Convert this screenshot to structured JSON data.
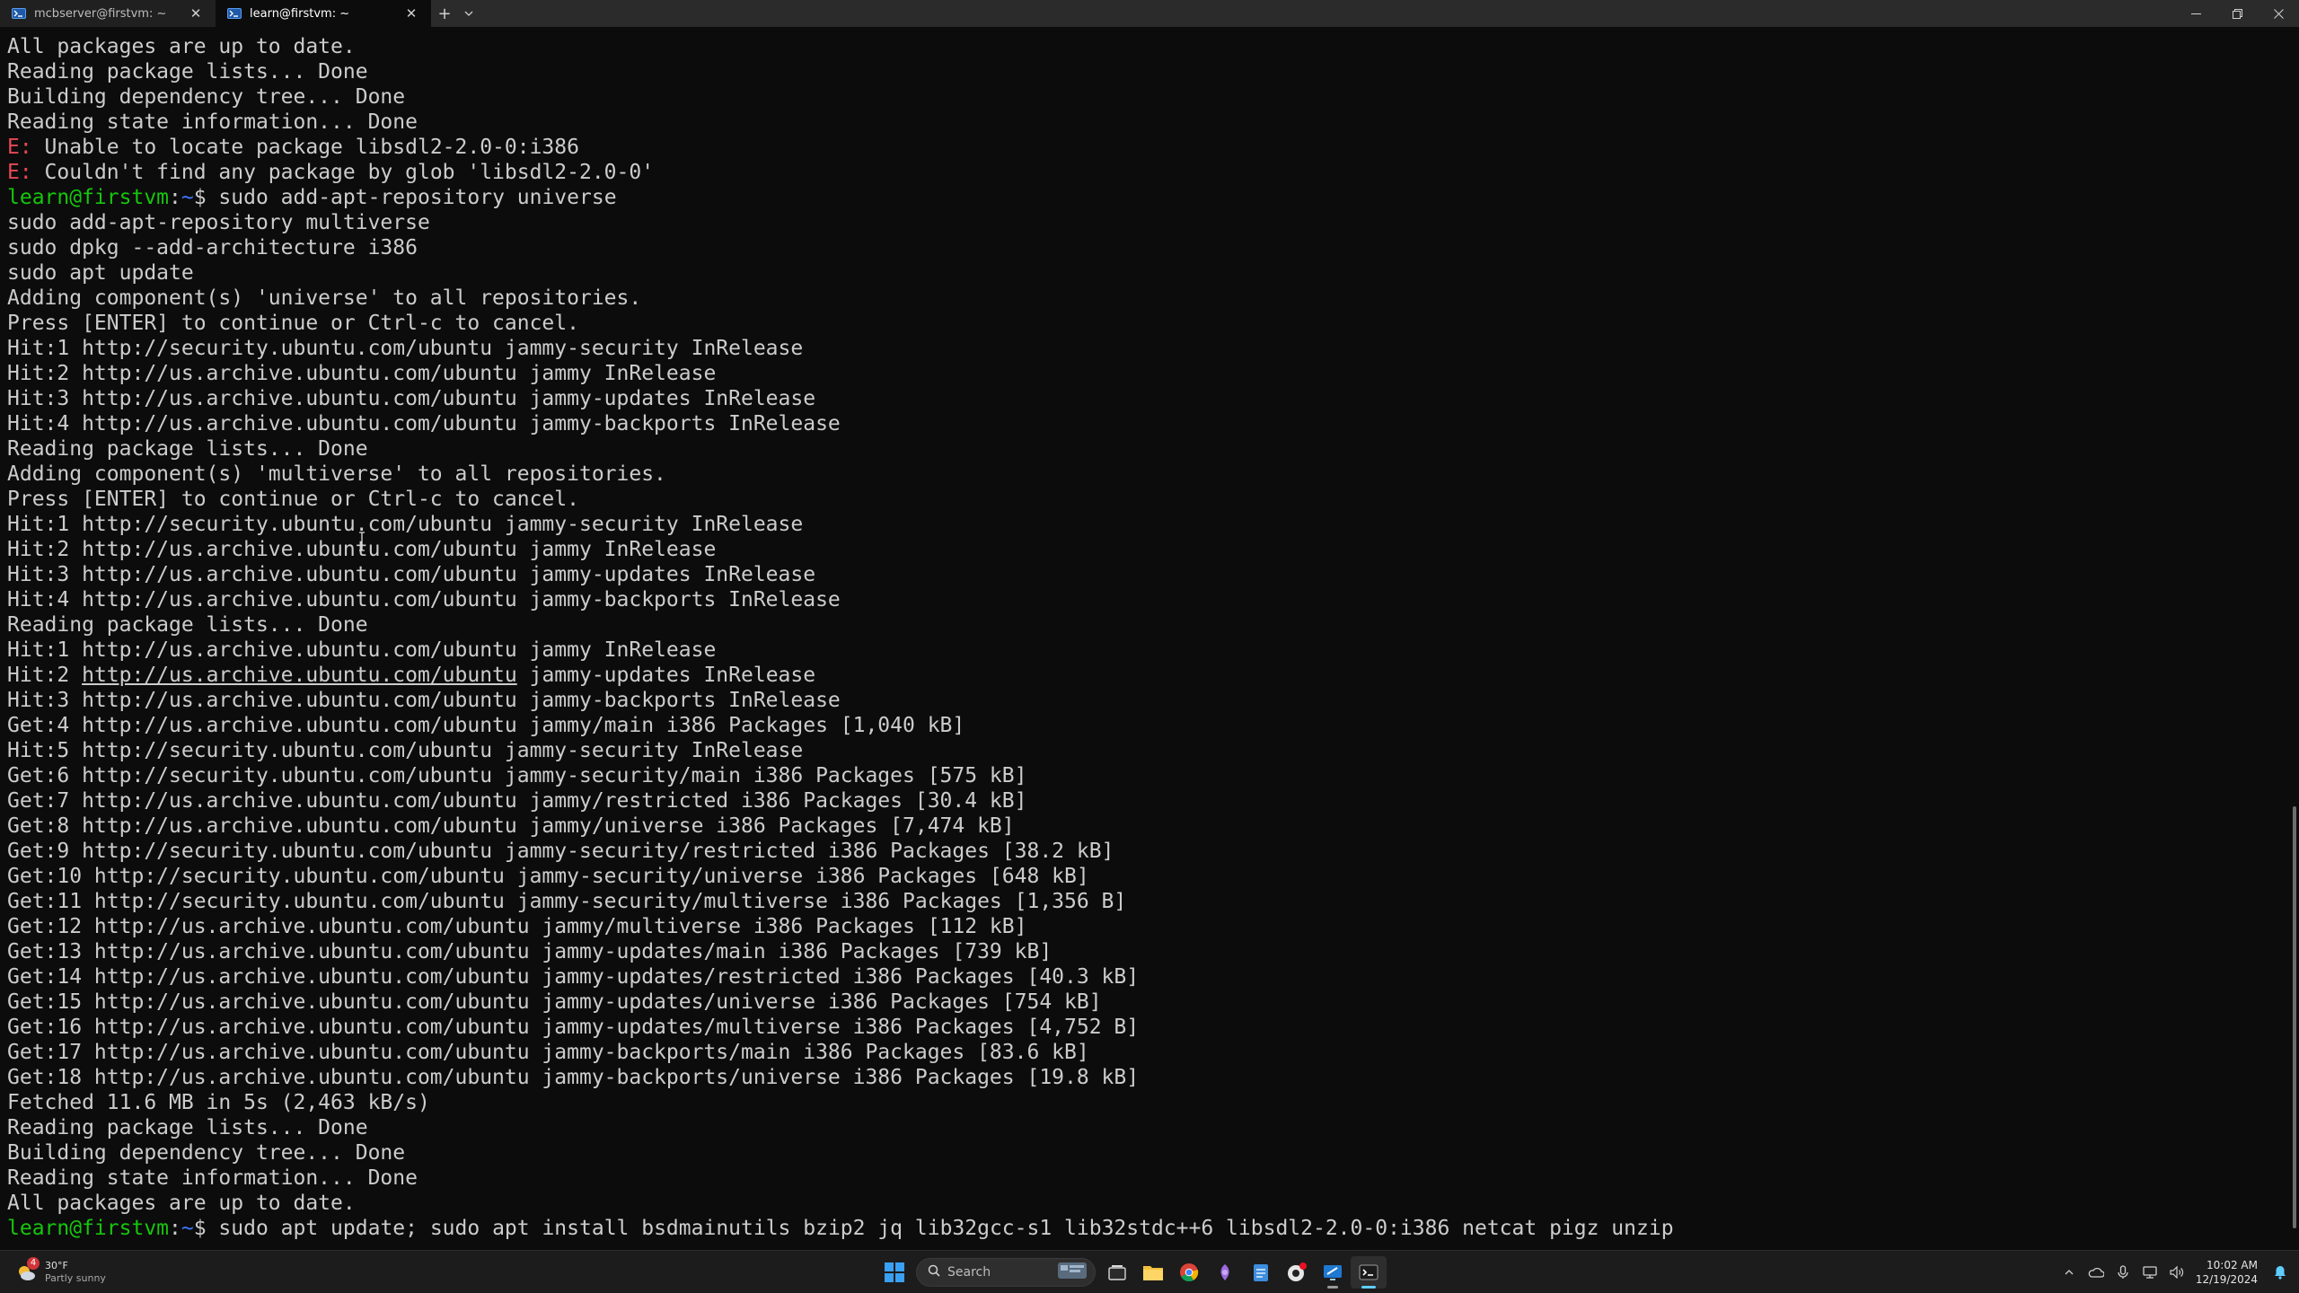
{
  "tabs": [
    {
      "title": "mcbserver@firstvm: ~",
      "active": false
    },
    {
      "title": "learn@firstvm: ~",
      "active": true
    }
  ],
  "tabbar": {
    "new_tab": "+",
    "dropdown": "⌄"
  },
  "window_controls": {
    "minimize": "—",
    "restore": "❐",
    "close": "✕"
  },
  "colors": {
    "background": "#0c0c0c",
    "foreground": "#cccccc",
    "error": "#e74856",
    "prompt_user": "#16c60c",
    "prompt_path": "#3b78ff"
  },
  "terminal": {
    "lines": [
      [
        {
          "t": "All packages are up to date."
        }
      ],
      [
        {
          "t": "Reading package lists... Done"
        }
      ],
      [
        {
          "t": "Building dependency tree... Done"
        }
      ],
      [
        {
          "t": "Reading state information... Done"
        }
      ],
      [
        {
          "t": "E:",
          "c": "err"
        },
        {
          "t": " Unable to locate package libsdl2-2.0-0:i386"
        }
      ],
      [
        {
          "t": "E:",
          "c": "err"
        },
        {
          "t": " Couldn't find any package by glob 'libsdl2-2.0-0'"
        }
      ],
      [
        {
          "t": "learn@firstvm",
          "c": "prompt-user"
        },
        {
          "t": ":"
        },
        {
          "t": "~",
          "c": "prompt-path"
        },
        {
          "t": "$ sudo add-apt-repository universe"
        }
      ],
      [
        {
          "t": "sudo add-apt-repository multiverse"
        }
      ],
      [
        {
          "t": "sudo dpkg --add-architecture i386"
        }
      ],
      [
        {
          "t": "sudo apt update"
        }
      ],
      [
        {
          "t": "Adding component(s) 'universe' to all repositories."
        }
      ],
      [
        {
          "t": "Press [ENTER] to continue or Ctrl-c to cancel."
        }
      ],
      [
        {
          "t": "Hit:1 http://security.ubuntu.com/ubuntu jammy-security InRelease"
        }
      ],
      [
        {
          "t": "Hit:2 http://us.archive.ubuntu.com/ubuntu jammy InRelease"
        }
      ],
      [
        {
          "t": "Hit:3 http://us.archive.ubuntu.com/ubuntu jammy-updates InRelease"
        }
      ],
      [
        {
          "t": "Hit:4 http://us.archive.ubuntu.com/ubuntu jammy-backports InRelease"
        }
      ],
      [
        {
          "t": "Reading package lists... Done"
        }
      ],
      [
        {
          "t": "Adding component(s) 'multiverse' to all repositories."
        }
      ],
      [
        {
          "t": "Press [ENTER] to continue or Ctrl-c to cancel."
        }
      ],
      [
        {
          "t": "Hit:1 http://security.ubuntu.com/ubuntu jammy-security InRelease"
        }
      ],
      [
        {
          "t": "Hit:2 http://us.archive.ubuntu.com/ubuntu jammy InRelease"
        }
      ],
      [
        {
          "t": "Hit:3 http://us.archive.ubuntu.com/ubuntu jammy-updates InRelease"
        }
      ],
      [
        {
          "t": "Hit:4 http://us.archive.ubuntu.com/ubuntu jammy-backports InRelease"
        }
      ],
      [
        {
          "t": "Reading package lists... Done"
        }
      ],
      [
        {
          "t": "Hit:1 http://us.archive.ubuntu.com/ubuntu jammy InRelease"
        }
      ],
      [
        {
          "t": "Hit:2 "
        },
        {
          "t": "http://us.archive.ubuntu.com/ubuntu",
          "c": "link"
        },
        {
          "t": " jammy-updates InRelease"
        }
      ],
      [
        {
          "t": "Hit:3 http://us.archive.ubuntu.com/ubuntu jammy-backports InRelease"
        }
      ],
      [
        {
          "t": "Get:4 http://us.archive.ubuntu.com/ubuntu jammy/main i386 Packages [1,040 kB]"
        }
      ],
      [
        {
          "t": "Hit:5 http://security.ubuntu.com/ubuntu jammy-security InRelease"
        }
      ],
      [
        {
          "t": "Get:6 http://security.ubuntu.com/ubuntu jammy-security/main i386 Packages [575 kB]"
        }
      ],
      [
        {
          "t": "Get:7 http://us.archive.ubuntu.com/ubuntu jammy/restricted i386 Packages [30.4 kB]"
        }
      ],
      [
        {
          "t": "Get:8 http://us.archive.ubuntu.com/ubuntu jammy/universe i386 Packages [7,474 kB]"
        }
      ],
      [
        {
          "t": "Get:9 http://security.ubuntu.com/ubuntu jammy-security/restricted i386 Packages [38.2 kB]"
        }
      ],
      [
        {
          "t": "Get:10 http://security.ubuntu.com/ubuntu jammy-security/universe i386 Packages [648 kB]"
        }
      ],
      [
        {
          "t": "Get:11 http://security.ubuntu.com/ubuntu jammy-security/multiverse i386 Packages [1,356 B]"
        }
      ],
      [
        {
          "t": "Get:12 http://us.archive.ubuntu.com/ubuntu jammy/multiverse i386 Packages [112 kB]"
        }
      ],
      [
        {
          "t": "Get:13 http://us.archive.ubuntu.com/ubuntu jammy-updates/main i386 Packages [739 kB]"
        }
      ],
      [
        {
          "t": "Get:14 http://us.archive.ubuntu.com/ubuntu jammy-updates/restricted i386 Packages [40.3 kB]"
        }
      ],
      [
        {
          "t": "Get:15 http://us.archive.ubuntu.com/ubuntu jammy-updates/universe i386 Packages [754 kB]"
        }
      ],
      [
        {
          "t": "Get:16 http://us.archive.ubuntu.com/ubuntu jammy-updates/multiverse i386 Packages [4,752 B]"
        }
      ],
      [
        {
          "t": "Get:17 http://us.archive.ubuntu.com/ubuntu jammy-backports/main i386 Packages [83.6 kB]"
        }
      ],
      [
        {
          "t": "Get:18 http://us.archive.ubuntu.com/ubuntu jammy-backports/universe i386 Packages [19.8 kB]"
        }
      ],
      [
        {
          "t": "Fetched 11.6 MB in 5s (2,463 kB/s)"
        }
      ],
      [
        {
          "t": "Reading package lists... Done"
        }
      ],
      [
        {
          "t": "Building dependency tree... Done"
        }
      ],
      [
        {
          "t": "Reading state information... Done"
        }
      ],
      [
        {
          "t": "All packages are up to date."
        }
      ],
      [
        {
          "t": "learn@firstvm",
          "c": "prompt-user"
        },
        {
          "t": ":"
        },
        {
          "t": "~",
          "c": "prompt-path"
        },
        {
          "t": "$ sudo apt update; sudo apt install bsdmainutils bzip2 jq lib32gcc-s1 lib32stdc++6 libsdl2-2.0-0:i386 netcat pigz unzip"
        }
      ]
    ]
  },
  "taskbar": {
    "weather": {
      "temp": "30°F",
      "condition": "Partly sunny",
      "badge": "4"
    },
    "search_placeholder": "Search",
    "apps": [
      {
        "name": "task-view-icon",
        "running": false
      },
      {
        "name": "file-explorer-icon",
        "running": false
      },
      {
        "name": "chrome-icon",
        "running": false
      },
      {
        "name": "copilot-icon",
        "running": false
      },
      {
        "name": "notepad-icon",
        "running": false
      },
      {
        "name": "app-red-icon",
        "running": false
      },
      {
        "name": "remote-desktop-icon",
        "running": true
      },
      {
        "name": "terminal-icon",
        "running": true,
        "active": true
      }
    ],
    "tray": {
      "chevron": "^"
    },
    "clock": {
      "time": "10:02 AM",
      "date": "12/19/2024"
    }
  }
}
